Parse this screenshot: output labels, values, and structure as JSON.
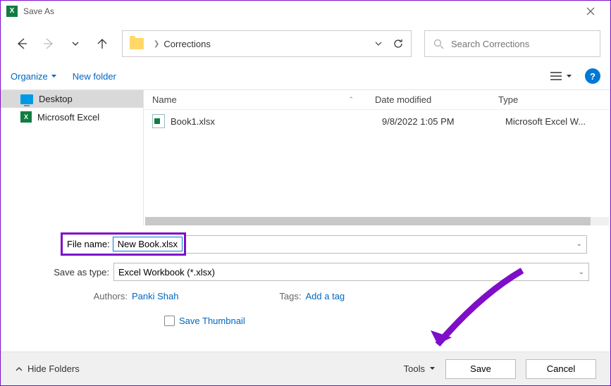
{
  "window": {
    "title": "Save As"
  },
  "nav": {
    "location": "Corrections",
    "search_placeholder": "Search Corrections"
  },
  "toolbar": {
    "organize": "Organize",
    "new_folder": "New folder"
  },
  "sidebar": {
    "items": [
      {
        "label": "Desktop",
        "selected": true,
        "icon": "desktop"
      },
      {
        "label": "Microsoft Excel",
        "selected": false,
        "icon": "excel"
      }
    ]
  },
  "columns": {
    "name": "Name",
    "date": "Date modified",
    "type": "Type"
  },
  "files": [
    {
      "name": "Book1.xlsx",
      "date": "9/8/2022 1:05 PM",
      "type": "Microsoft Excel W..."
    }
  ],
  "form": {
    "filename_label": "File name:",
    "filename_value": "New Book.xlsx",
    "savetype_label": "Save as type:",
    "savetype_value": "Excel Workbook (*.xlsx)",
    "authors_label": "Authors:",
    "authors_value": "Panki Shah",
    "tags_label": "Tags:",
    "tags_value": "Add a tag",
    "thumbnail_label": "Save Thumbnail"
  },
  "footer": {
    "hide_folders": "Hide Folders",
    "tools": "Tools",
    "save": "Save",
    "cancel": "Cancel"
  }
}
